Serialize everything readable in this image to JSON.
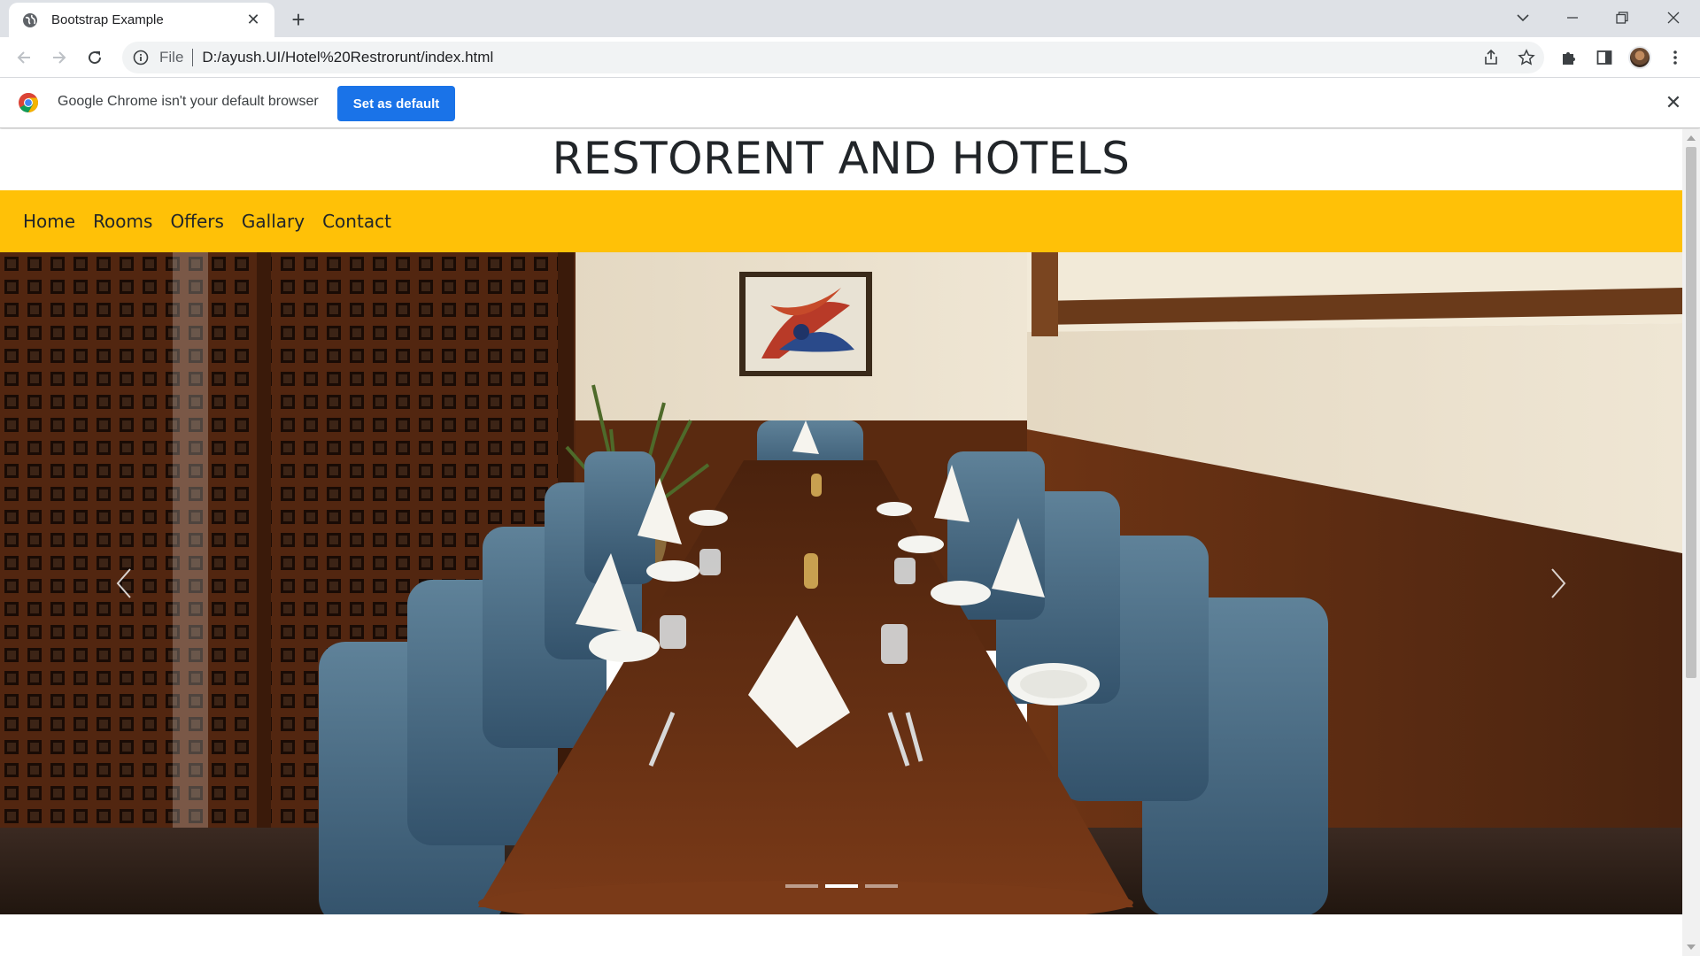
{
  "browser": {
    "tab_title": "Bootstrap Example",
    "address_scheme": "File",
    "address_url": "D:/ayush.UI/Hotel%20Restrorunt/index.html"
  },
  "infobar": {
    "message": "Google Chrome isn't your default browser",
    "button_label": "Set as default"
  },
  "page": {
    "site_title": "RESTORENT AND HOTELS",
    "nav_items": [
      "Home",
      "Rooms",
      "Offers",
      "Gallary",
      "Contact"
    ],
    "nav_color": "#ffc107",
    "carousel": {
      "slide_count": 3,
      "active_index": 1
    }
  },
  "colors": {
    "tabstrip": "#dee1e6",
    "accent": "#1a73e8"
  }
}
